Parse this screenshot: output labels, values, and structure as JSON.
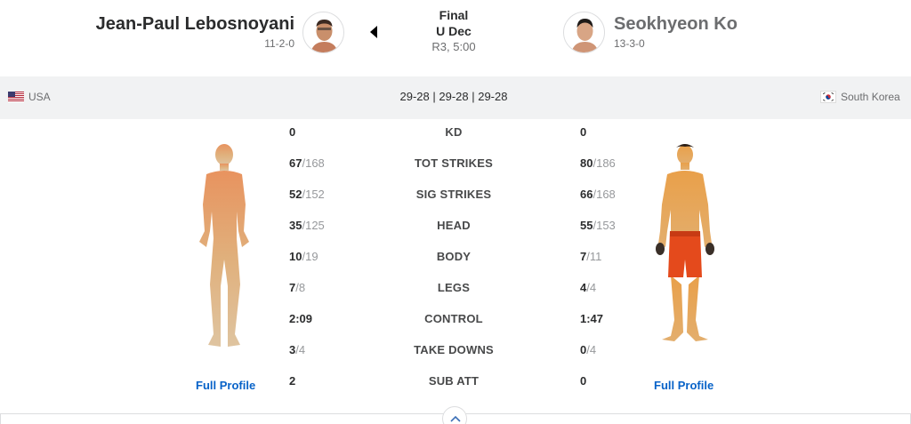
{
  "fighter1": {
    "name": "Jean-Paul Lebosnoyani",
    "record": "11-2-0",
    "country": "USA",
    "profile_link": "Full Profile"
  },
  "fighter2": {
    "name": "Seokhyeon Ko",
    "record": "13-3-0",
    "country": "South Korea",
    "profile_link": "Full Profile"
  },
  "result": {
    "status": "Final",
    "method": "U Dec",
    "time": "R3, 5:00",
    "winner": "fighter1"
  },
  "scores": "29-28 | 29-28 | 29-28",
  "stats": [
    {
      "label": "KD",
      "f1": "0",
      "f1_total": "",
      "f2": "0",
      "f2_total": ""
    },
    {
      "label": "TOT STRIKES",
      "f1": "67",
      "f1_total": "168",
      "f2": "80",
      "f2_total": "186"
    },
    {
      "label": "SIG STRIKES",
      "f1": "52",
      "f1_total": "152",
      "f2": "66",
      "f2_total": "168"
    },
    {
      "label": "HEAD",
      "f1": "35",
      "f1_total": "125",
      "f2": "55",
      "f2_total": "153"
    },
    {
      "label": "BODY",
      "f1": "10",
      "f1_total": "19",
      "f2": "7",
      "f2_total": "11"
    },
    {
      "label": "LEGS",
      "f1": "7",
      "f1_total": "8",
      "f2": "4",
      "f2_total": "4"
    },
    {
      "label": "CONTROL",
      "f1": "2:09",
      "f1_total": "",
      "f2": "1:47",
      "f2_total": ""
    },
    {
      "label": "TAKE DOWNS",
      "f1": "3",
      "f1_total": "4",
      "f2": "0",
      "f2_total": "4"
    },
    {
      "label": "SUB ATT",
      "f1": "2",
      "f1_total": "",
      "f2": "0",
      "f2_total": ""
    }
  ],
  "colors": {
    "link": "#0762c8",
    "text": "#2b2c2d",
    "muted": "#96989b",
    "bar": "#f1f2f3"
  },
  "icons": {
    "winner": "caret-left-icon",
    "collapse": "chevron-up-icon"
  }
}
